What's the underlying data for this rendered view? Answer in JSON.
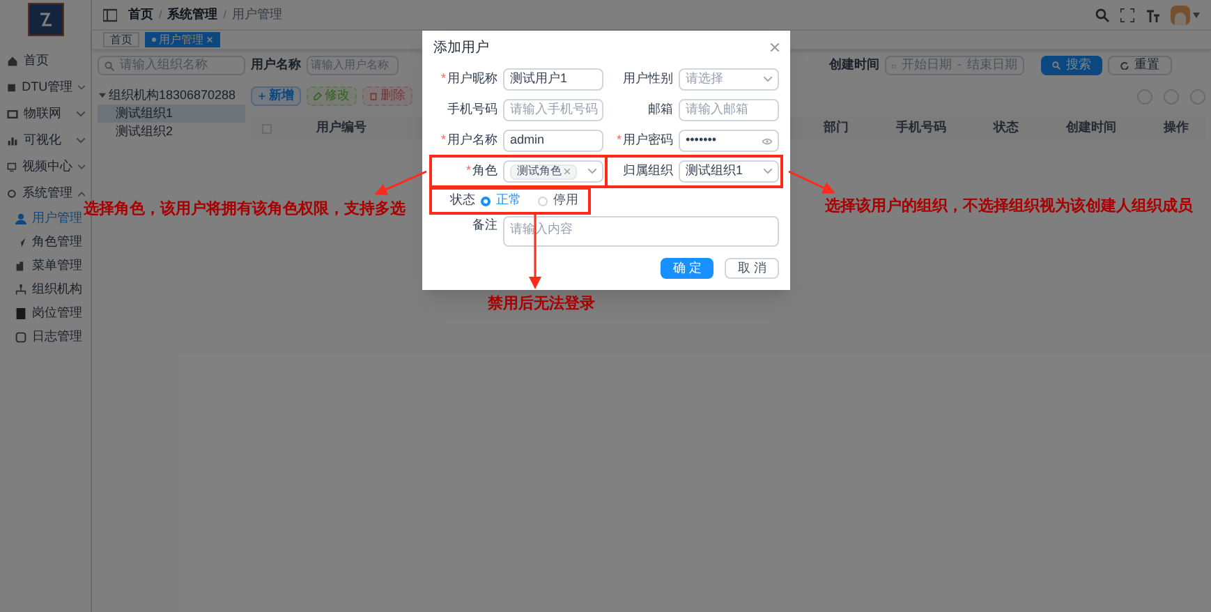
{
  "sidebar": {
    "items": [
      {
        "label": "首页",
        "selected": false
      },
      {
        "label": "DTU管理",
        "selected": false,
        "expanded": false
      },
      {
        "label": "物联网",
        "selected": false,
        "expanded": false
      },
      {
        "label": "可视化",
        "selected": false,
        "expanded": false
      },
      {
        "label": "视频中心",
        "selected": false,
        "expanded": false
      },
      {
        "label": "系统管理",
        "selected": false,
        "expanded": true,
        "children": [
          {
            "label": "用户管理",
            "selected": true
          },
          {
            "label": "角色管理",
            "selected": false
          },
          {
            "label": "菜单管理",
            "selected": false
          },
          {
            "label": "组织机构",
            "selected": false
          },
          {
            "label": "岗位管理",
            "selected": false
          },
          {
            "label": "日志管理",
            "selected": false
          }
        ]
      }
    ]
  },
  "header": {
    "breadcrumb": [
      "首页",
      "系统管理",
      "用户管理"
    ],
    "separators": [
      "/",
      "/"
    ]
  },
  "tags": [
    {
      "label": "首页",
      "selected": false
    },
    {
      "label": "用户管理",
      "selected": true
    }
  ],
  "org_panel": {
    "search_placeholder": "请输入组织名称",
    "tree": [
      {
        "label": "组织机构18306870288",
        "expanded": true,
        "children": [
          {
            "label": "测试组织1",
            "selected": true
          },
          {
            "label": "测试组织2",
            "selected": false
          }
        ]
      }
    ]
  },
  "query": {
    "user_name_label": "用户名称",
    "user_name_placeholder": "请输入用户名称",
    "created_label": "创建时间",
    "start_placeholder": "开始日期",
    "range_separator": "-",
    "end_placeholder": "结束日期",
    "search_button": "搜索",
    "reset_button": "重置"
  },
  "toolbar": [
    {
      "label": "新增",
      "kind": "primary",
      "disabled": false
    },
    {
      "label": "修改",
      "kind": "success",
      "disabled": true
    },
    {
      "label": "删除",
      "kind": "danger",
      "disabled": true
    }
  ],
  "table": {
    "select_all_checked": false,
    "columns_left": [
      "用户编号"
    ],
    "columns_right": [
      "部门",
      "手机号码",
      "状态",
      "创建时间",
      "操作"
    ]
  },
  "dialog": {
    "title": "添加用户",
    "required_marks": [
      "*",
      "*",
      "*",
      "*"
    ],
    "fields": [
      {
        "label": "用户昵称",
        "required": true,
        "kind": "input",
        "value": "测试用户1"
      },
      {
        "label": "用户性别",
        "required": false,
        "kind": "select",
        "placeholder": "请选择"
      },
      {
        "label": "手机号码",
        "required": false,
        "kind": "input",
        "placeholder": "请输入手机号码"
      },
      {
        "label": "邮箱",
        "required": false,
        "kind": "input",
        "placeholder": "请输入邮箱"
      },
      {
        "label": "用户名称",
        "required": true,
        "kind": "input",
        "value": "admin"
      },
      {
        "label": "用户密码",
        "required": true,
        "kind": "password",
        "value": "•••••••"
      },
      {
        "label": "角色",
        "required": true,
        "kind": "tags",
        "tags": [
          "测试角色"
        ],
        "highlighted": true
      },
      {
        "label": "归属组织",
        "required": false,
        "kind": "select",
        "value": "测试组织1",
        "highlighted": true
      }
    ],
    "status": {
      "label": "状态",
      "highlighted": true,
      "options": [
        {
          "label": "正常",
          "selected": true
        },
        {
          "label": "停用",
          "selected": false
        }
      ]
    },
    "remark": {
      "label": "备注",
      "placeholder": "请输入内容"
    },
    "buttons": [
      {
        "label": "确 定",
        "kind": "primary"
      },
      {
        "label": "取 消",
        "kind": "default"
      }
    ]
  },
  "annotations": [
    {
      "text": "选择角色，该用户将拥有该角色权限，支持多选"
    },
    {
      "text": "选择该用户的组织，不选择组织视为该创建人组织成员"
    },
    {
      "text": "禁用后无法登录"
    }
  ]
}
